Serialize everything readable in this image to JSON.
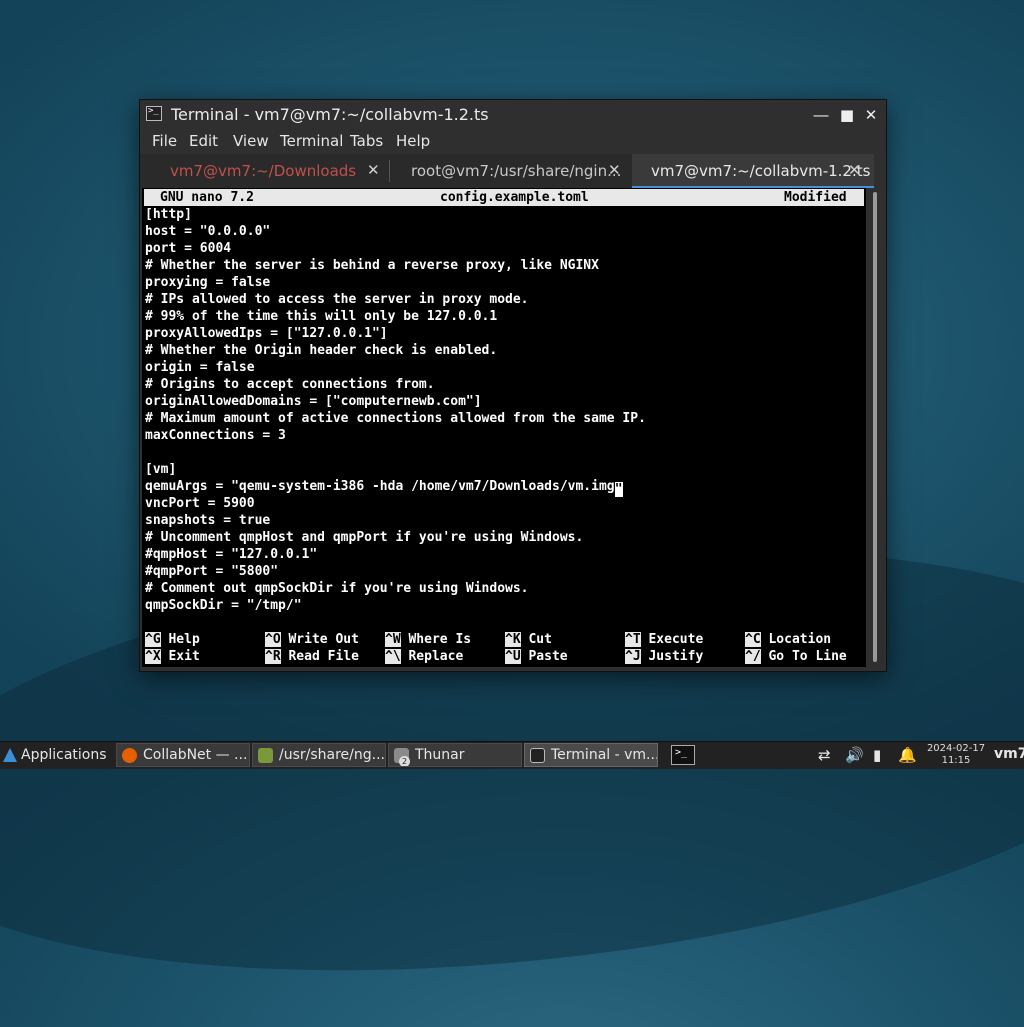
{
  "window": {
    "title": "Terminal - vm7@vm7:~/collabvm-1.2.ts",
    "controls": {
      "minimize": "―",
      "maximize": "■",
      "close": "✕"
    }
  },
  "menu": [
    "File",
    "Edit",
    "View",
    "Terminal",
    "Tabs",
    "Help"
  ],
  "tabs": [
    {
      "label": "vm7@vm7:~/Downloads",
      "color": "#c0504d",
      "active": false
    },
    {
      "label": "root@vm7:/usr/share/ngin...",
      "color": "#c8c8c8",
      "active": false
    },
    {
      "label": "vm7@vm7:~/collabvm-1.2.ts",
      "color": "#e8e8e8",
      "active": true
    }
  ],
  "tab_close": "✕",
  "nano": {
    "version": "GNU nano 7.2",
    "filename": "config.example.toml",
    "status": "Modified"
  },
  "lines": [
    "[http]",
    "host = \"0.0.0.0\"",
    "port = 6004",
    "# Whether the server is behind a reverse proxy, like NGINX",
    "proxying = false",
    "# IPs allowed to access the server in proxy mode.",
    "# 99% of the time this will only be 127.0.0.1",
    "proxyAllowedIps = [\"127.0.0.1\"]",
    "# Whether the Origin header check is enabled.",
    "origin = false",
    "# Origins to accept connections from.",
    "originAllowedDomains = [\"computernewb.com\"]",
    "# Maximum amount of active connections allowed from the same IP.",
    "maxConnections = 3",
    "",
    "[vm]",
    "qemuArgs = \"qemu-system-i386 -hda /home/vm7/Downloads/vm.img",
    "vncPort = 5900",
    "snapshots = true",
    "# Uncomment qmpHost and qmpPort if you're using Windows.",
    "#qmpHost = \"127.0.0.1\"",
    "#qmpPort = \"5800\"",
    "# Comment out qmpSockDir if you're using Windows.",
    "qmpSockDir = \"/tmp/\""
  ],
  "cursor_char": "\"",
  "shortcuts": [
    {
      "key": "^G",
      "label": "Help"
    },
    {
      "key": "^O",
      "label": "Write Out"
    },
    {
      "key": "^W",
      "label": "Where Is"
    },
    {
      "key": "^K",
      "label": "Cut"
    },
    {
      "key": "^T",
      "label": "Execute"
    },
    {
      "key": "^C",
      "label": "Location"
    },
    {
      "key": "^X",
      "label": "Exit"
    },
    {
      "key": "^R",
      "label": "Read File"
    },
    {
      "key": "^\\",
      "label": "Replace"
    },
    {
      "key": "^U",
      "label": "Paste"
    },
    {
      "key": "^J",
      "label": "Justify"
    },
    {
      "key": "^/",
      "label": "Go To Line"
    }
  ],
  "taskbar": {
    "applications": "Applications",
    "tasks": [
      {
        "label": "CollabNet — ...",
        "icon": "firefox-icon",
        "color": "#e66000"
      },
      {
        "label": "/usr/share/ng...",
        "icon": "text-editor-icon",
        "color": "#7a9a3a"
      },
      {
        "label": "Thunar",
        "icon": "file-manager-icon",
        "color": "#8a8a8a",
        "badge": "2"
      },
      {
        "label": "Terminal - vm...",
        "icon": "terminal-icon",
        "color": "#222222"
      }
    ],
    "clock_date": "2024-02-17",
    "clock_time": "11:15",
    "user": "vm7"
  }
}
